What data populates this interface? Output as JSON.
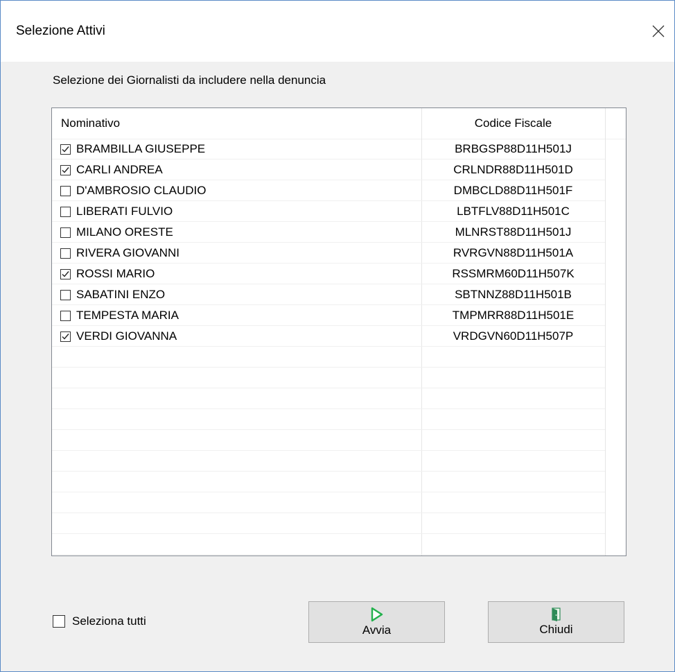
{
  "window": {
    "title": "Selezione Attivi"
  },
  "instruction": "Selezione dei Giornalisti da includere nella denuncia",
  "table": {
    "columns": [
      "Nominativo",
      "Codice Fiscale"
    ],
    "rows": [
      {
        "name": "BRAMBILLA GIUSEPPE",
        "cf": "BRBGSP88D11H501J",
        "checked": true
      },
      {
        "name": "CARLI ANDREA",
        "cf": "CRLNDR88D11H501D",
        "checked": true
      },
      {
        "name": "D'AMBROSIO CLAUDIO",
        "cf": "DMBCLD88D11H501F",
        "checked": false
      },
      {
        "name": "LIBERATI FULVIO",
        "cf": "LBTFLV88D11H501C",
        "checked": false
      },
      {
        "name": "MILANO ORESTE",
        "cf": "MLNRST88D11H501J",
        "checked": false
      },
      {
        "name": "RIVERA GIOVANNI",
        "cf": "RVRGVN88D11H501A",
        "checked": false
      },
      {
        "name": "ROSSI MARIO",
        "cf": "RSSMRM60D11H507K",
        "checked": true
      },
      {
        "name": "SABATINI ENZO",
        "cf": "SBTNNZ88D11H501B",
        "checked": false
      },
      {
        "name": "TEMPESTA MARIA",
        "cf": "TMPMRR88D11H501E",
        "checked": false
      },
      {
        "name": "VERDI GIOVANNA",
        "cf": "VRDGVN60D11H507P",
        "checked": true
      }
    ]
  },
  "select_all": {
    "label": "Seleziona tutti",
    "checked": false
  },
  "buttons": {
    "run": {
      "label": "Avvia",
      "icon": "play-icon",
      "color": "#22b14c"
    },
    "close": {
      "label": "Chiudi",
      "icon": "door-exit-icon",
      "color": "#2e8b57"
    }
  }
}
